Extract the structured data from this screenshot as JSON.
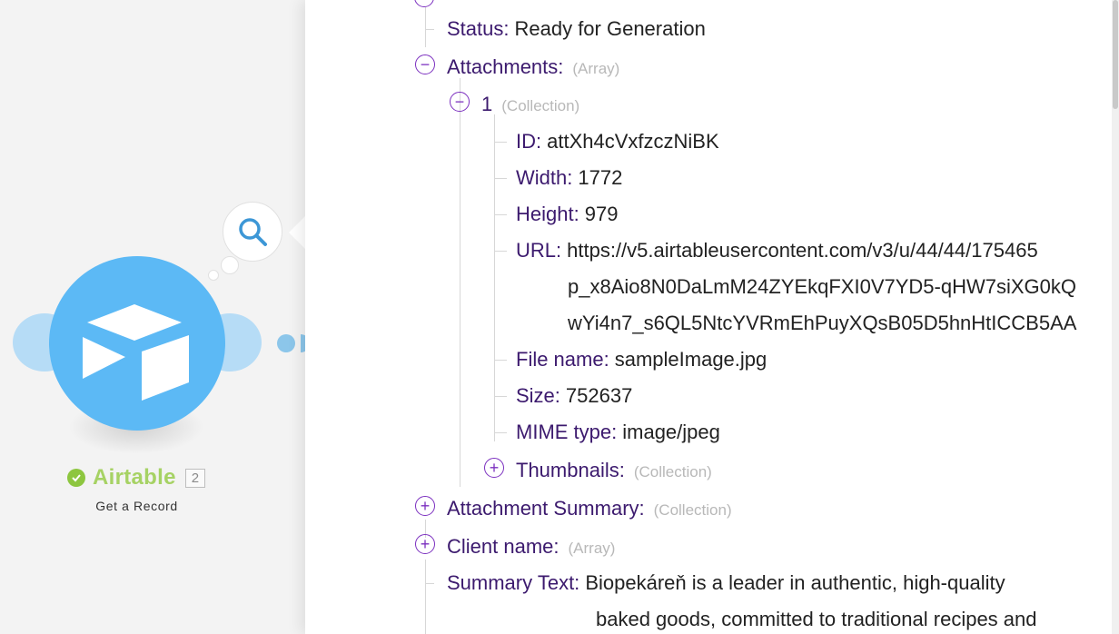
{
  "module": {
    "name": "Airtable",
    "badge": "2",
    "subtitle": "Get a Record",
    "brand_color": "#5cb9f5",
    "status_color": "#8dc63f",
    "icons": [
      "search-icon",
      "airtable-logo-icon",
      "check-icon"
    ]
  },
  "output": {
    "status": {
      "key": "Status:",
      "value": "Ready for Generation"
    },
    "attachments": {
      "key": "Attachments:",
      "type": "(Array)",
      "items": [
        {
          "key": "1",
          "type": "(Collection)",
          "fields": {
            "id": {
              "key": "ID:",
              "value": "attXh4cVxfzczNiBK"
            },
            "width": {
              "key": "Width:",
              "value": "1772"
            },
            "height": {
              "key": "Height:",
              "value": "979"
            },
            "url": {
              "key": "URL:",
              "line1": "https://v5.airtableusercontent.com/v3/u/44/44/175465",
              "line2": "p_x8Aio8N0DaLmM24ZYEkqFXI0V7YD5-qHW7siXG0kQ",
              "line3": "wYi4n7_s6QL5NtcYVRmEhPuyXQsB05D5hnHtICCB5AA"
            },
            "file_name": {
              "key": "File name:",
              "value": "sampleImage.jpg"
            },
            "size": {
              "key": "Size:",
              "value": "752637"
            },
            "mime_type": {
              "key": "MIME type:",
              "value": "image/jpeg"
            },
            "thumbnails": {
              "key": "Thumbnails:",
              "type": "(Collection)"
            }
          }
        }
      ]
    },
    "attachment_summary": {
      "key": "Attachment Summary:",
      "type": "(Collection)"
    },
    "client_name": {
      "key": "Client name:",
      "type": "(Array)"
    },
    "summary_text": {
      "key": "Summary Text:",
      "line1": "Biopekáreň is a leader in authentic, high-quality",
      "line2": "baked goods, committed to traditional recipes and"
    }
  },
  "colors": {
    "key_text": "#3c1a6e",
    "toggle": "#7b2fbf",
    "type_hint": "#b8b8b8",
    "tree_line": "#d7d7d7"
  }
}
